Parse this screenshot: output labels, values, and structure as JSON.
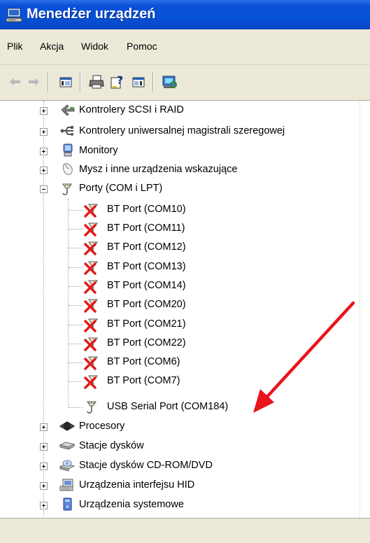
{
  "window": {
    "title": "Menedżer urządzeń",
    "icon": "computer-manager-icon"
  },
  "menu": [
    {
      "label": "Plik"
    },
    {
      "label": "Akcja"
    },
    {
      "label": "Widok"
    },
    {
      "label": "Pomoc"
    }
  ],
  "toolbar": {
    "buttons": [
      "back-arrow-icon",
      "forward-arrow-icon",
      "console-tree-icon",
      "print-icon",
      "help-icon",
      "details-pane-icon",
      "scan-hardware-icon"
    ]
  },
  "tree": {
    "categories_top": [
      {
        "label": "Kontrolery SCSI i RAID",
        "icon": "scsi-controller-icon",
        "state": "collapsed"
      },
      {
        "label": "Kontrolery uniwersalnej magistrali szeregowej",
        "icon": "usb-controller-icon",
        "state": "collapsed"
      },
      {
        "label": "Monitory",
        "icon": "monitor-icon",
        "state": "collapsed"
      },
      {
        "label": "Mysz i inne urządzenia wskazujące",
        "icon": "mouse-icon",
        "state": "collapsed"
      },
      {
        "label": "Porty (COM i LPT)",
        "icon": "port-icon",
        "state": "expanded"
      }
    ],
    "ports": [
      {
        "label": "BT Port (COM10)",
        "icon": "port-disabled-icon"
      },
      {
        "label": "BT Port (COM11)",
        "icon": "port-disabled-icon"
      },
      {
        "label": "BT Port (COM12)",
        "icon": "port-disabled-icon"
      },
      {
        "label": "BT Port (COM13)",
        "icon": "port-disabled-icon"
      },
      {
        "label": "BT Port (COM14)",
        "icon": "port-disabled-icon"
      },
      {
        "label": "BT Port (COM20)",
        "icon": "port-disabled-icon"
      },
      {
        "label": "BT Port (COM21)",
        "icon": "port-disabled-icon"
      },
      {
        "label": "BT Port (COM22)",
        "icon": "port-disabled-icon"
      },
      {
        "label": "BT Port (COM6)",
        "icon": "port-disabled-icon"
      },
      {
        "label": "BT Port (COM7)",
        "icon": "port-disabled-icon"
      },
      {
        "label": "USB Serial Port (COM184)",
        "icon": "port-icon"
      }
    ],
    "categories_bottom": [
      {
        "label": "Procesory",
        "icon": "processor-icon",
        "state": "collapsed"
      },
      {
        "label": "Stacje dysków",
        "icon": "floppy-drive-icon",
        "state": "collapsed"
      },
      {
        "label": "Stacje dysków CD-ROM/DVD",
        "icon": "cdrom-icon",
        "state": "collapsed"
      },
      {
        "label": "Urządzenia interfejsu HID",
        "icon": "hid-device-icon",
        "state": "collapsed"
      },
      {
        "label": "Urządzenia systemowe",
        "icon": "system-device-icon",
        "state": "collapsed"
      }
    ]
  },
  "annotation": {
    "arrow_color": "#e8141b",
    "target": "USB Serial Port (COM184)"
  },
  "colors": {
    "titlebar": "#0552d6",
    "chrome": "#ece9d8",
    "disabled_x": "#e31b1b"
  }
}
